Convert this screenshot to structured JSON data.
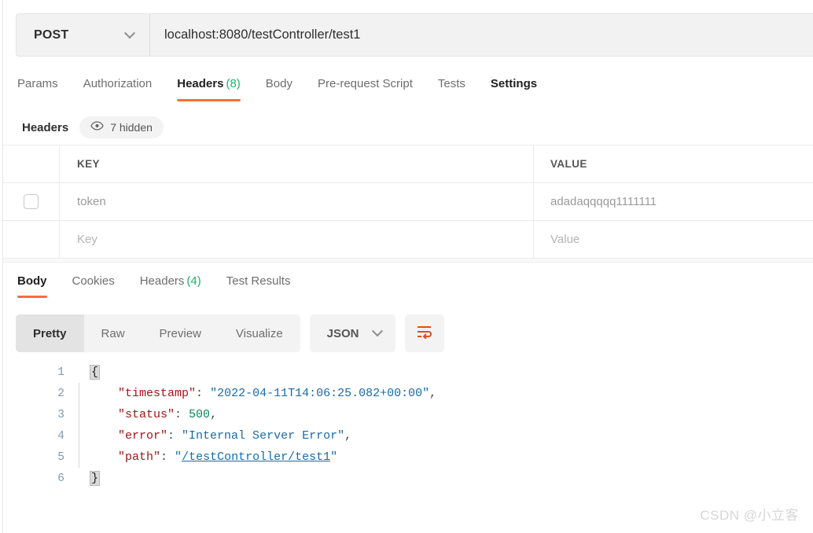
{
  "request_bar": {
    "method": "POST",
    "method_dropdown_icon": "chevron-down-icon",
    "url": "localhost:8080/testController/test1"
  },
  "request_tabs": [
    {
      "label": "Params",
      "count": "",
      "active": false
    },
    {
      "label": "Authorization",
      "count": "",
      "active": false
    },
    {
      "label": "Headers",
      "count": "(8)",
      "active": true
    },
    {
      "label": "Body",
      "count": "",
      "active": false
    },
    {
      "label": "Pre-request Script",
      "count": "",
      "active": false
    },
    {
      "label": "Tests",
      "count": "",
      "active": false
    },
    {
      "label": "Settings",
      "count": "",
      "active": false
    }
  ],
  "headers_section": {
    "title": "Headers",
    "hidden_pill": {
      "icon": "eye-icon",
      "label": "7 hidden"
    },
    "columns": {
      "key": "KEY",
      "value": "VALUE"
    },
    "rows": [
      {
        "checked": false,
        "key": "token",
        "value": "adadaqqqqq1111111",
        "is_placeholder": false
      },
      {
        "checked": false,
        "key": "Key",
        "value": "Value",
        "is_placeholder": true
      }
    ]
  },
  "response_tabs": [
    {
      "label": "Body",
      "count": "",
      "active": true
    },
    {
      "label": "Cookies",
      "count": "",
      "active": false
    },
    {
      "label": "Headers",
      "count": "(4)",
      "active": false
    },
    {
      "label": "Test Results",
      "count": "",
      "active": false
    }
  ],
  "body_toolbar": {
    "segments": [
      {
        "label": "Pretty",
        "active": true
      },
      {
        "label": "Raw",
        "active": false
      },
      {
        "label": "Preview",
        "active": false
      },
      {
        "label": "Visualize",
        "active": false
      }
    ],
    "format": {
      "label": "JSON",
      "dropdown_icon": "chevron-down-icon"
    },
    "wrap_button_icon": "wrap-text-icon"
  },
  "response_body": {
    "line_numbers": [
      "1",
      "2",
      "3",
      "4",
      "5",
      "6"
    ],
    "lines": [
      {
        "open_brace": "{"
      },
      {
        "key": "\"timestamp\"",
        "sep": ": ",
        "value": "\"2022-04-11T14:06:25.082+00:00\"",
        "tail": ","
      },
      {
        "key": "\"status\"",
        "sep": ": ",
        "value": "500",
        "tail": ","
      },
      {
        "key": "\"error\"",
        "sep": ": ",
        "value": "\"Internal Server Error\"",
        "tail": ","
      },
      {
        "key": "\"path\"",
        "sep": ": ",
        "value": "\"/testController/test1\"",
        "tail": ""
      },
      {
        "close_brace": "}"
      }
    ]
  },
  "watermark": "CSDN @小立客",
  "colors": {
    "accent_orange": "#ff6c37",
    "count_green": "#19b36b",
    "json_key": "#a31515",
    "json_string": "#1a6aa8",
    "json_number": "#098658"
  }
}
